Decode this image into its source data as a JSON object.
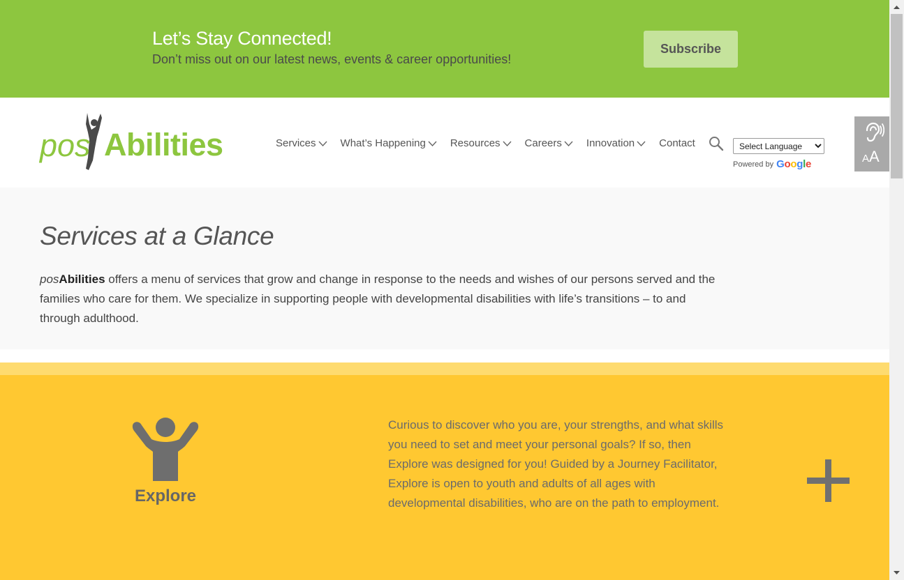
{
  "banner": {
    "title": "Let’s Stay Connected!",
    "subtitle": "Don’t miss out on our latest news, events & career opportunities!",
    "subscribe_label": "Subscribe",
    "background": "#8dc63f"
  },
  "logo": {
    "pos": "pos",
    "abilities": "Abilities",
    "color": "#8dc63f"
  },
  "nav": {
    "items": [
      {
        "label": "Services",
        "dropdown": true
      },
      {
        "label": "What’s Happening",
        "dropdown": true
      },
      {
        "label": "Resources",
        "dropdown": true
      },
      {
        "label": "Careers",
        "dropdown": true
      },
      {
        "label": "Innovation",
        "dropdown": true
      },
      {
        "label": "Contact",
        "dropdown": false
      }
    ],
    "search_icon": "search-icon"
  },
  "translate": {
    "select_value": "Select Language",
    "powered_by": "Powered by",
    "brand": "Google"
  },
  "accessibility": {
    "icon": "hearing-icon",
    "text_small": "A",
    "text_large": "A"
  },
  "glance": {
    "title": "Services at a Glance",
    "brand_pos": "pos",
    "brand_abilities": "Abilities",
    "text": " offers a menu of services that grow and change in response to the needs and wishes of our persons served and the families who care for them. We specialize in supporting people with developmental disabilities with life’s transitions – to and through adulthood."
  },
  "explore": {
    "label": "Explore",
    "description": "Curious to discover who you are, your strengths, and what skills you need to set and meet your personal goals? If so, then Explore was designed for you! Guided by a Journey Facilitator, Explore is open to youth and adults of all ages with developmental disabilities, who are on the path to employment.",
    "expand_icon": "plus-icon",
    "background": "#ffc831",
    "stripe": "#fedb6f"
  }
}
